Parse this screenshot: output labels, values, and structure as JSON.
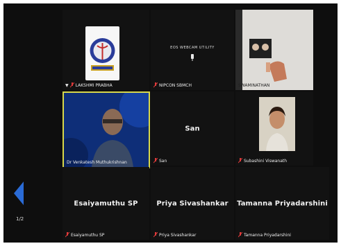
{
  "pager": {
    "indicator": "1/2"
  },
  "tiles": {
    "lakshmi": {
      "name": "LAKSHMI PRABHA"
    },
    "nipcon": {
      "name": "NIPCON SBMCH",
      "camera_caption": "EOS WEBCAM UTILITY"
    },
    "swaminathan": {
      "name": "SWAMINATHAN"
    },
    "venkatesh": {
      "name": "Dr Venkatesh Muthukrishnan"
    },
    "san": {
      "name": "San",
      "center": "San"
    },
    "subashini": {
      "name": "Subashini Viswanath"
    },
    "esaiyamuthu": {
      "name": "Esaiyamuthu SP",
      "center": "Esaiyamuthu SP"
    },
    "priya": {
      "name": "Priya Sivashankar",
      "center": "Priya Sivashankar"
    },
    "tamanna": {
      "name": "Tamanna Priyadarshini",
      "center": "Tamanna Priyadarshini"
    }
  },
  "colors": {
    "active_speaker_border": "#d8d84a",
    "mute_icon": "#e03a3a",
    "page_arrow": "#2a6bd6"
  },
  "icons": {
    "muted": "mic-muted-icon",
    "pin": "pin-icon",
    "prev": "arrow-left-icon"
  }
}
